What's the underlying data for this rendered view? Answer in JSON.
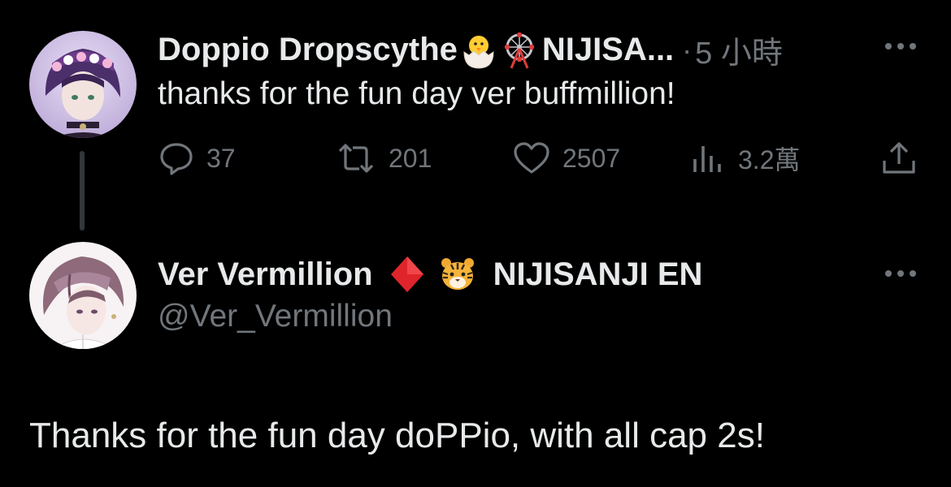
{
  "parent_tweet": {
    "display_name": "Doppio Dropscythe",
    "name_suffix": "NIJISA...",
    "separator": "·",
    "timestamp": "5 小時",
    "text": "thanks for the fun day ver buffmillion!",
    "metrics": {
      "replies": "37",
      "retweets": "201",
      "likes": "2507",
      "views": "3.2萬"
    }
  },
  "main_tweet": {
    "display_name": "Ver Vermillion",
    "affiliation": "NIJISANJI EN",
    "handle": "@Ver_Vermillion",
    "text": "Thanks for the fun day doPPio, with all cap 2s!"
  },
  "icons": {
    "parent_emojis": [
      "hatching-chick-emoji",
      "ferris-wheel-emoji"
    ],
    "main_emojis": [
      "red-diamond-emoji",
      "tiger-face-emoji"
    ],
    "actions": [
      "reply-icon",
      "retweet-icon",
      "like-icon",
      "views-icon",
      "share-icon"
    ],
    "more": "more-icon"
  },
  "colors": {
    "background": "#000000",
    "text_primary": "#e7e9ea",
    "text_secondary": "#71767b",
    "thread_line": "#333639"
  }
}
